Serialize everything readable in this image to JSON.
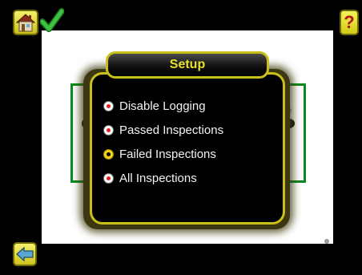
{
  "toolbar": {
    "home_icon": "home-icon",
    "status_icon": "checkmark-icon",
    "help_label": "?",
    "back_icon": "back-arrow-icon"
  },
  "dialog": {
    "title": "Setup",
    "options": [
      {
        "label": "Disable Logging",
        "selected": false
      },
      {
        "label": "Passed Inspections",
        "selected": false
      },
      {
        "label": "Failed Inspections",
        "selected": true
      },
      {
        "label": "All Inspections",
        "selected": false
      }
    ]
  },
  "colors": {
    "accent_yellow": "#c8c018",
    "title_text": "#e8e12a",
    "pass_green": "#2fae2f",
    "frame_green": "#0a8a1e",
    "background": "#000000"
  }
}
